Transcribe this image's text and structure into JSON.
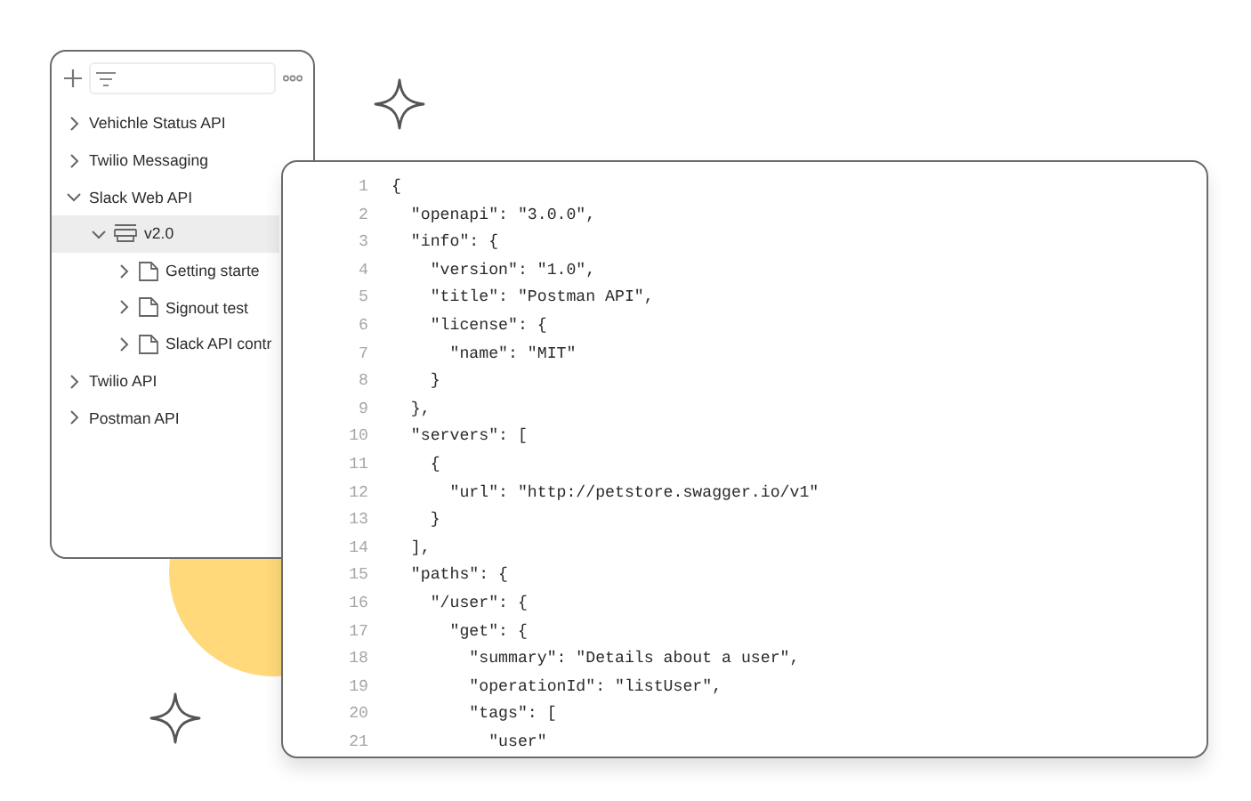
{
  "sidebar": {
    "items": [
      {
        "kind": "collection",
        "label": "Vehichle Status API",
        "expanded": false,
        "selected": false
      },
      {
        "kind": "collection",
        "label": "Twilio Messaging",
        "expanded": false,
        "selected": false
      },
      {
        "kind": "collection",
        "label": "Slack Web API",
        "expanded": true,
        "selected": false,
        "children": [
          {
            "kind": "version",
            "label": "v2.0",
            "expanded": true,
            "selected": true,
            "children": [
              {
                "kind": "document",
                "label": "Getting starte",
                "expanded": false,
                "selected": false
              },
              {
                "kind": "document",
                "label": "Signout test",
                "expanded": false,
                "selected": false
              },
              {
                "kind": "document",
                "label": "Slack API contr",
                "expanded": false,
                "selected": false
              }
            ]
          }
        ]
      },
      {
        "kind": "collection",
        "label": "Twilio API",
        "expanded": false,
        "selected": false
      },
      {
        "kind": "collection",
        "label": "Postman API",
        "expanded": false,
        "selected": false
      }
    ]
  },
  "editor": {
    "lines": [
      {
        "number": "1",
        "text": "{"
      },
      {
        "number": "2",
        "text": "  \"openapi\": \"3.0.0\","
      },
      {
        "number": "3",
        "text": "  \"info\": {"
      },
      {
        "number": "4",
        "text": "    \"version\": \"1.0\","
      },
      {
        "number": "5",
        "text": "    \"title\": \"Postman API\","
      },
      {
        "number": "6",
        "text": "    \"license\": {"
      },
      {
        "number": "7",
        "text": "      \"name\": \"MIT\""
      },
      {
        "number": "8",
        "text": "    }"
      },
      {
        "number": "9",
        "text": "  },"
      },
      {
        "number": "10",
        "text": "  \"servers\": ["
      },
      {
        "number": "11",
        "text": "    {"
      },
      {
        "number": "12",
        "text": "      \"url\": \"http://petstore.swagger.io/v1\""
      },
      {
        "number": "13",
        "text": "    }"
      },
      {
        "number": "14",
        "text": "  ],"
      },
      {
        "number": "15",
        "text": "  \"paths\": {"
      },
      {
        "number": "16",
        "text": "    \"/user\": {"
      },
      {
        "number": "17",
        "text": "      \"get\": {"
      },
      {
        "number": "18",
        "text": "        \"summary\": \"Details about a user\","
      },
      {
        "number": "19",
        "text": "        \"operationId\": \"listUser\","
      },
      {
        "number": "20",
        "text": "        \"tags\": ["
      },
      {
        "number": "21",
        "text": "          \"user\""
      }
    ]
  }
}
